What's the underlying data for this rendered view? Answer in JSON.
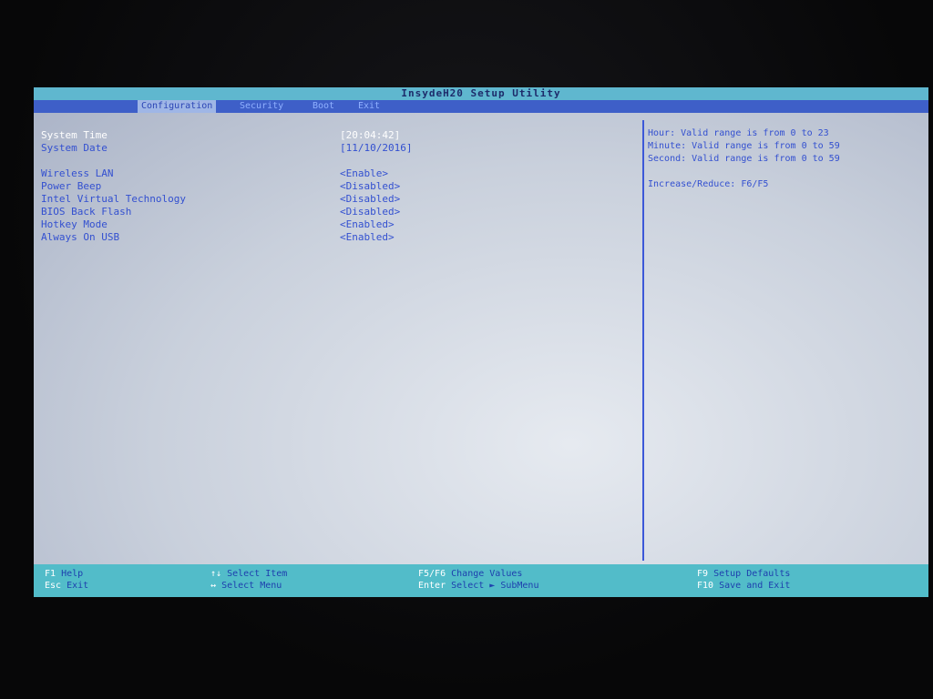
{
  "title": "InsydeH20 Setup Utility",
  "menu": {
    "items": [
      {
        "label": "Configuration"
      },
      {
        "label": "Security"
      },
      {
        "label": "Boot"
      },
      {
        "label": "Exit"
      }
    ]
  },
  "settings": [
    {
      "label": "System Time",
      "value": "[20:04:42]"
    },
    {
      "label": "System Date",
      "value": "[11/10/2016]"
    },
    {
      "label": "Wireless LAN",
      "value": "<Enable>"
    },
    {
      "label": "Power Beep",
      "value": "<Disabled>"
    },
    {
      "label": "Intel Virtual Technology",
      "value": "<Disabled>"
    },
    {
      "label": "BIOS Back Flash",
      "value": "<Disabled>"
    },
    {
      "label": "Hotkey Mode",
      "value": "<Enabled>"
    },
    {
      "label": "Always On USB",
      "value": "<Enabled>"
    }
  ],
  "help": {
    "lines": [
      "Hour: Valid range is from 0 to 23",
      "Minute: Valid range is from 0 to 59",
      "Second: Valid range is from 0 to 59"
    ],
    "hint": "Increase/Reduce: F6/F5"
  },
  "footer": {
    "help": {
      "key": "F1",
      "label": "Help"
    },
    "exit": {
      "key": "Esc",
      "label": "Exit"
    },
    "select_item": {
      "key": "↑↓",
      "label": "Select Item"
    },
    "select_menu": {
      "key": "↔",
      "label": "Select Menu"
    },
    "change_values": {
      "key": "F5/F6",
      "label": "Change Values"
    },
    "submenu": {
      "key": "Enter",
      "label": "Select ► SubMenu"
    },
    "defaults": {
      "key": "F9",
      "label": "Setup Defaults"
    },
    "save_exit": {
      "key": "F10",
      "label": "Save and Exit"
    }
  },
  "colors": {
    "title_bar": "#5fb7cf",
    "menu_bar": "#3e5fc8",
    "text_blue": "#3350d0",
    "footer_bar": "#52bcc9"
  }
}
